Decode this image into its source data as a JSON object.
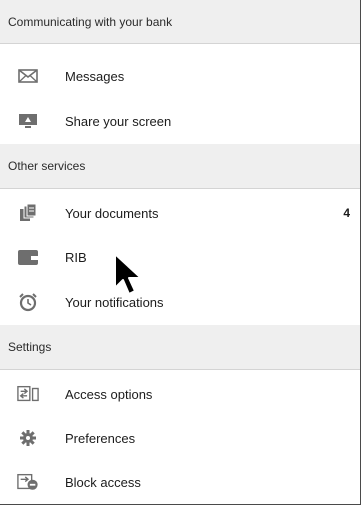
{
  "sections": [
    {
      "title": "Communicating with your bank",
      "items": [
        {
          "label": "Messages",
          "icon": "envelope-icon"
        },
        {
          "label": "Share your screen",
          "icon": "screen-share-icon"
        }
      ]
    },
    {
      "title": "Other services",
      "items": [
        {
          "label": "Your documents",
          "icon": "documents-icon",
          "badge": "4"
        },
        {
          "label": "RIB",
          "icon": "wallet-icon"
        },
        {
          "label": "Your notifications",
          "icon": "alarm-clock-icon"
        }
      ]
    },
    {
      "title": "Settings",
      "items": [
        {
          "label": "Access options",
          "icon": "access-options-icon"
        },
        {
          "label": "Preferences",
          "icon": "gear-icon"
        },
        {
          "label": "Block access",
          "icon": "block-access-icon"
        }
      ]
    }
  ],
  "colors": {
    "header_bg": "#efefef",
    "icon": "#6e6e6e",
    "text": "#1c1c1c"
  }
}
